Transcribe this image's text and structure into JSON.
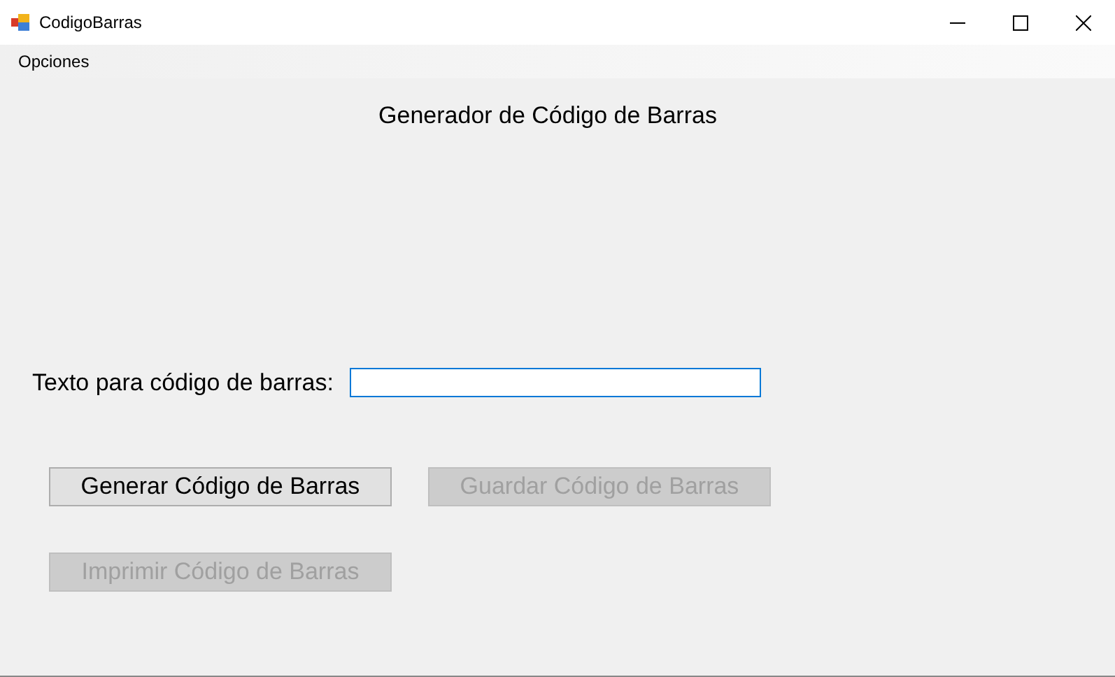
{
  "window": {
    "title": "CodigoBarras"
  },
  "menu": [
    {
      "label": "Opciones"
    }
  ],
  "heading": "Generador de Código de Barras",
  "text_field": {
    "label": "Texto para código de barras:",
    "focused": true
  },
  "buttons": [
    {
      "label": "Generar Código de Barras",
      "disabled": false
    },
    {
      "label": "Guardar Código de Barras",
      "disabled": true
    },
    {
      "label": "Imprimir Código de Barras",
      "disabled": true
    }
  ]
}
